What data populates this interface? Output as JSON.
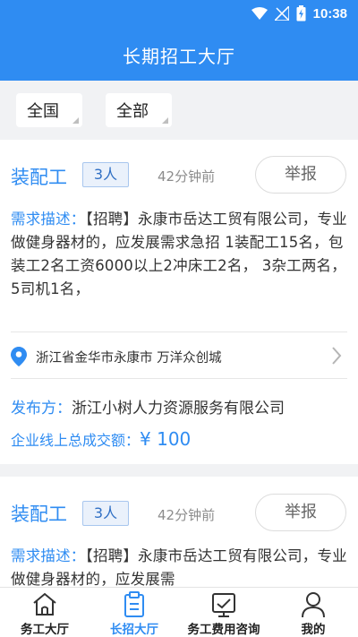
{
  "status_bar": {
    "time": "10:38"
  },
  "header": {
    "title": "长期招工大厅"
  },
  "filters": {
    "region": "全国",
    "category": "全部"
  },
  "jobs": [
    {
      "title": "装配工",
      "count": "3人",
      "time": "42分钟前",
      "report_label": "举报",
      "desc_label": "需求描述：",
      "desc_text": "【招聘】永康市岳达工贸有限公司，专业做健身器材的，应发展需求急招 1装配工15名，包装工2名工资6000以上2冲床工2名， 3杂工两名， 5司机1名，",
      "location": "浙江省金华市永康市 万洋众创城",
      "publisher_label": "发布方：",
      "publisher": "浙江小树人力资源服务有限公司",
      "total_label": "企业线上总成交额：",
      "total_amount": "¥ 100"
    },
    {
      "title": "装配工",
      "count": "3人",
      "time": "42分钟前",
      "report_label": "举报",
      "desc_label": "需求描述：",
      "desc_text": "【招聘】永康市岳达工贸有限公司，专业做健身器材的，应发展需"
    }
  ],
  "tabbar": {
    "items": [
      {
        "label": "务工大厅",
        "icon": "home-icon",
        "active": false
      },
      {
        "label": "长招大厅",
        "icon": "clipboard-icon",
        "active": true
      },
      {
        "label": "务工费用咨询",
        "icon": "chart-board-icon",
        "active": false
      },
      {
        "label": "我的",
        "icon": "user-icon",
        "active": false
      }
    ]
  },
  "colors": {
    "primary": "#2f8cf2",
    "background": "#f1f2f4",
    "muted": "#8c8c8c"
  }
}
